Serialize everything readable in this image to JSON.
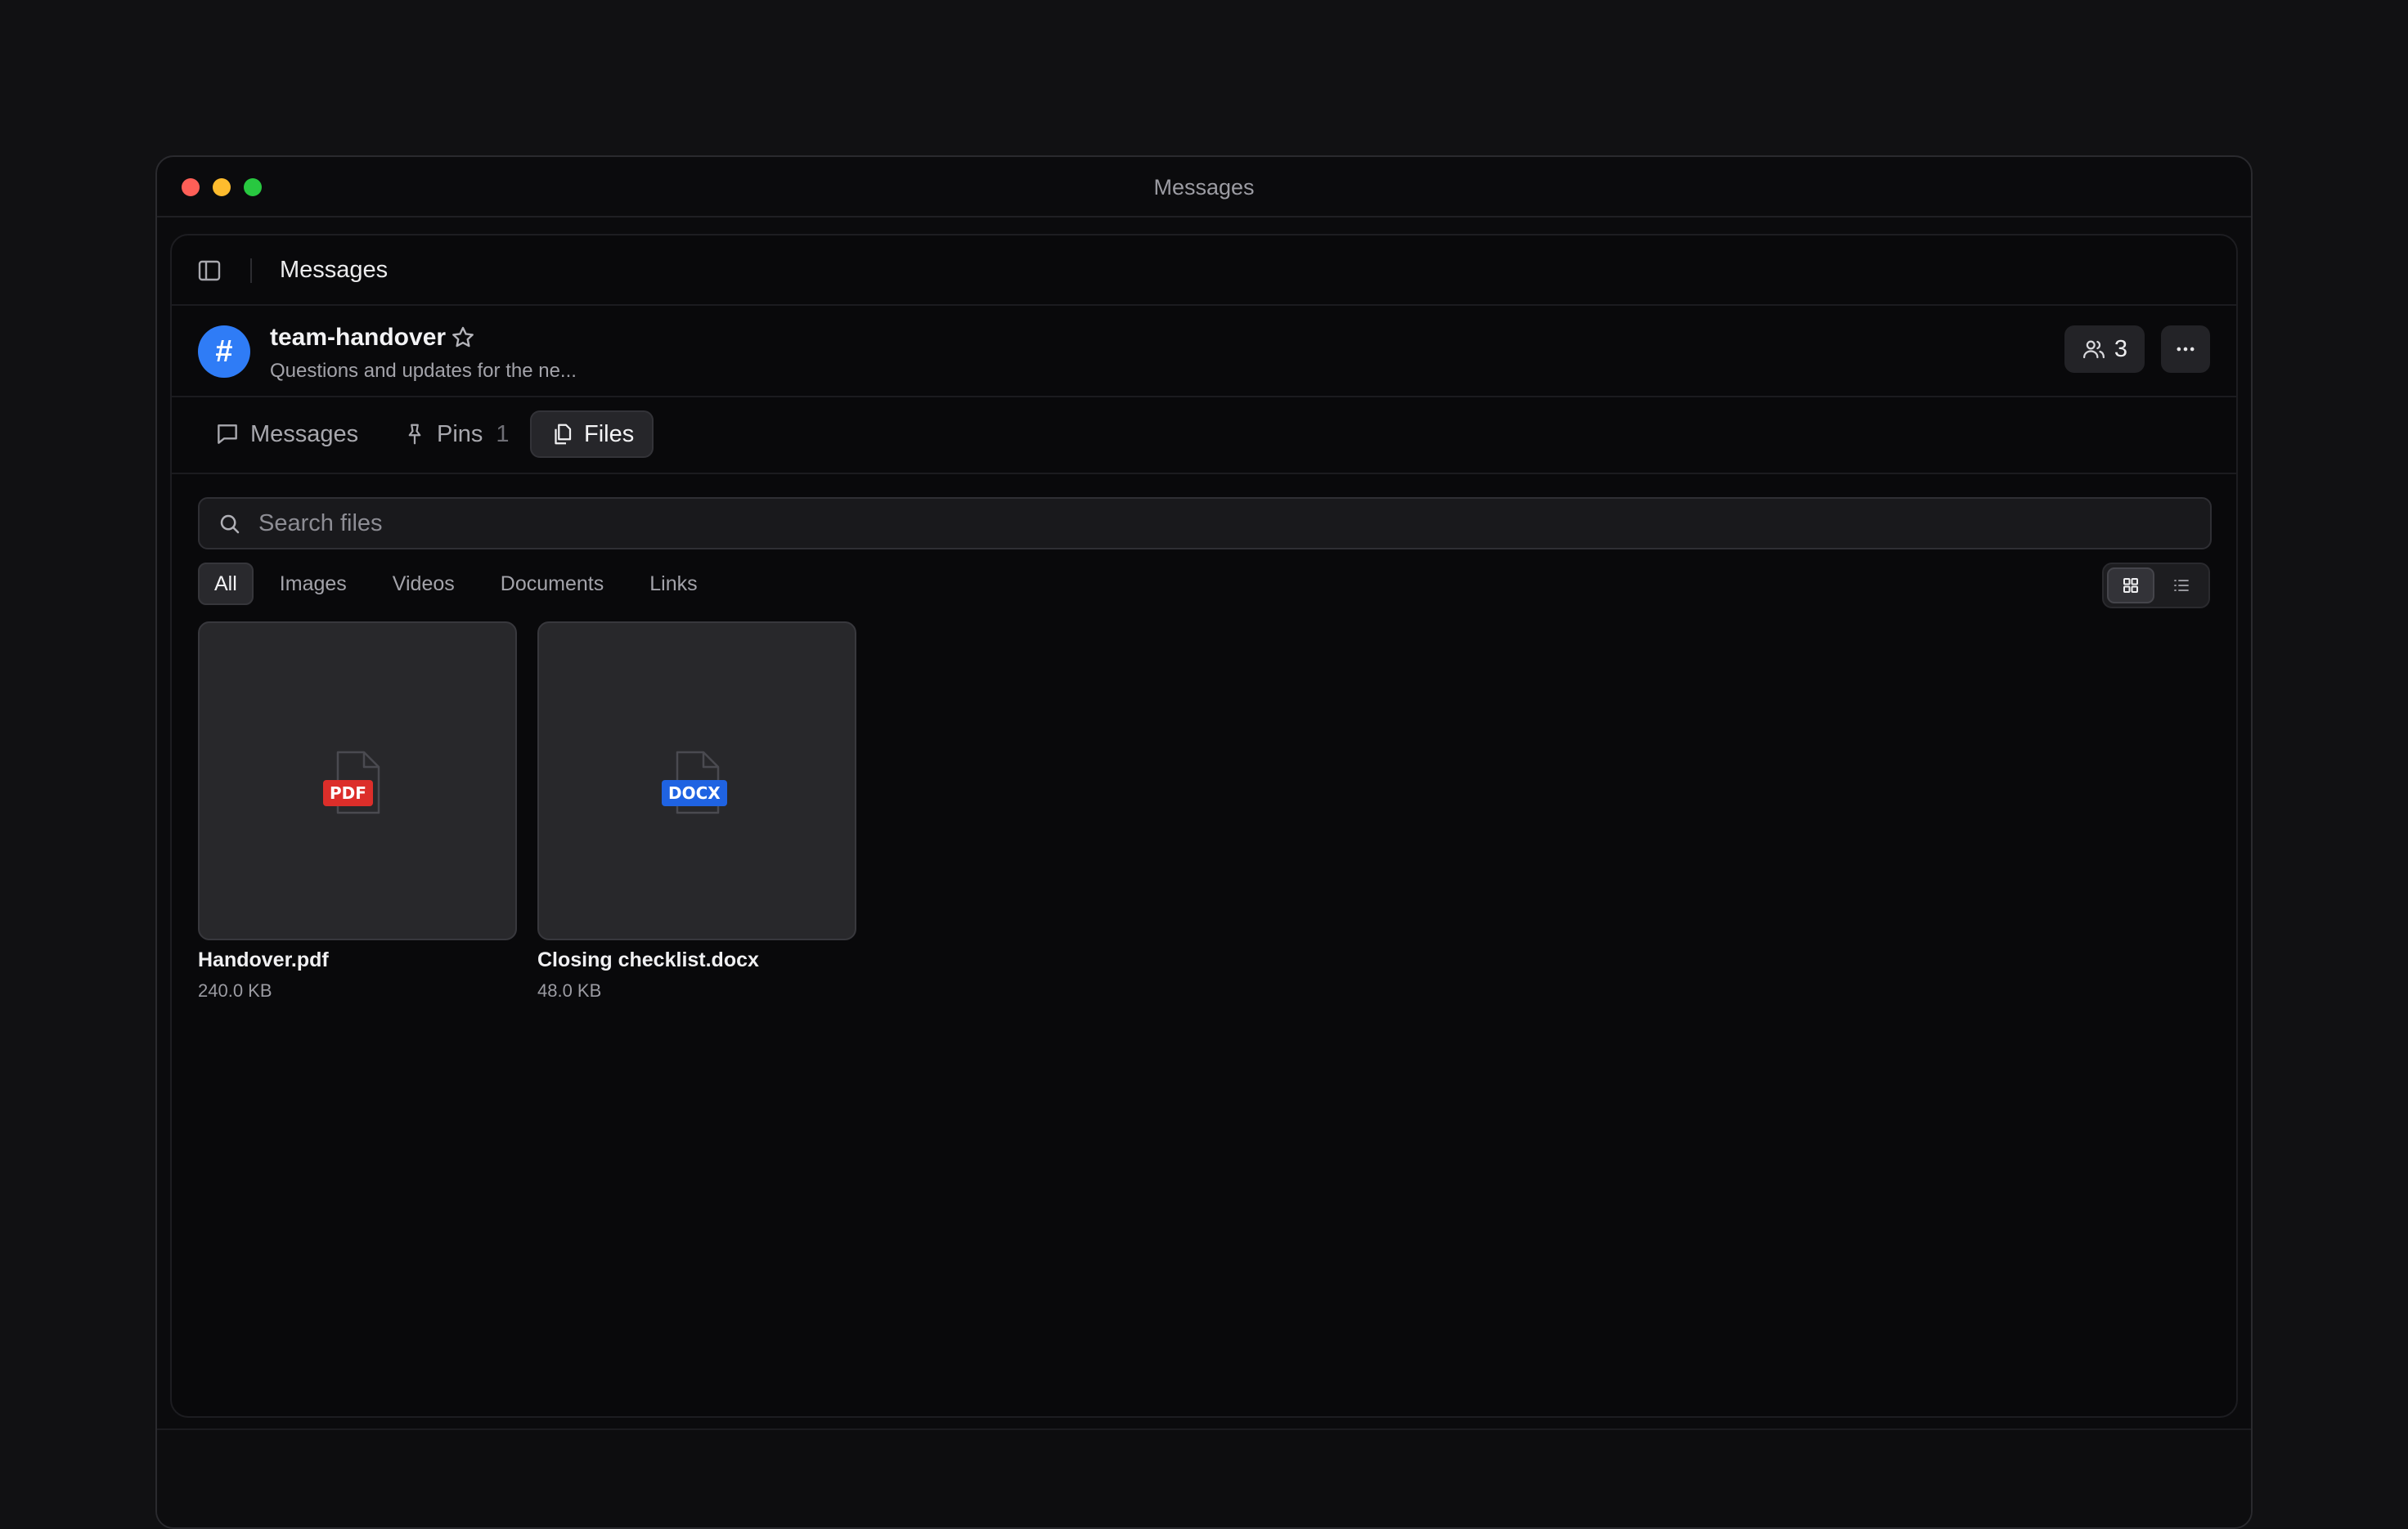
{
  "window": {
    "title": "Messages"
  },
  "topbar": {
    "title": "Messages"
  },
  "channel": {
    "avatar_glyph": "#",
    "name": "team-handover",
    "description": "Questions and updates for the ne...",
    "member_count": "3",
    "avatar_color": "#2f7cf6"
  },
  "tabs": [
    {
      "label": "Messages",
      "icon": "message-icon"
    },
    {
      "label": "Pins",
      "icon": "pin-icon",
      "count": "1"
    },
    {
      "label": "Files",
      "icon": "files-icon",
      "active": true
    }
  ],
  "search": {
    "placeholder": "Search files",
    "value": ""
  },
  "filters": [
    {
      "label": "All",
      "active": true
    },
    {
      "label": "Images"
    },
    {
      "label": "Videos"
    },
    {
      "label": "Documents"
    },
    {
      "label": "Links"
    }
  ],
  "view_mode": "grid",
  "files": [
    {
      "name": "Handover.pdf",
      "size": "240.0 KB",
      "badge": "PDF",
      "badge_color": "#dc2e2a"
    },
    {
      "name": "Closing checklist.docx",
      "size": "48.0 KB",
      "badge": "DOCX",
      "badge_color": "#1f63e2"
    }
  ]
}
